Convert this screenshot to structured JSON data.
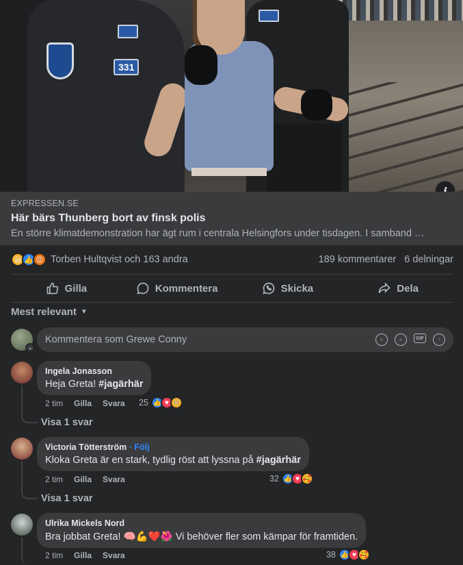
{
  "link": {
    "domain": "EXPRESSEN.SE",
    "title": "Här bärs Thunberg bort av finsk polis",
    "description": "En större klimatdemonstration har ägt rum i centrala Helsingfors under tisdagen. I samband …",
    "photo_badge_number": "331"
  },
  "summary": {
    "reactions": [
      "haha",
      "like",
      "angry"
    ],
    "names": "Torben Hultqvist och 163 andra",
    "comments": "189 kommentarer",
    "shares": "6 delningar"
  },
  "actions": {
    "like": "Gilla",
    "comment": "Kommentera",
    "send": "Skicka",
    "share": "Dela"
  },
  "sort_label": "Mest relevant",
  "composer": {
    "placeholder": "Kommentera som Grewe Conny"
  },
  "comments": [
    {
      "author": "Ingela Jonasson",
      "follow": "",
      "text": "Heja Greta! ",
      "tag": "#jagärhär",
      "time": "2 tim",
      "like": "Gilla",
      "reply": "Svara",
      "count": "25",
      "reactions": [
        "like",
        "love",
        "haha"
      ],
      "view_replies": "Visa 1 svar"
    },
    {
      "author": "Victoria Tötterström",
      "follow": "· Följ",
      "text": "Kloka Greta är en stark, tydlig röst att lyssna på ",
      "tag": "#jagärhär",
      "time": "2 tim",
      "like": "Gilla",
      "reply": "Svara",
      "count": "32",
      "reactions": [
        "like",
        "love",
        "care"
      ],
      "view_replies": "Visa 1 svar"
    },
    {
      "author": "Ulrika Mickels Nord",
      "follow": "",
      "text": "Bra jobbat Greta! 🧠💪❤️🌺 Vi behöver fler som kämpar för framtiden.",
      "tag": "",
      "time": "2 tim",
      "like": "Gilla",
      "reply": "Svara",
      "count": "38",
      "reactions": [
        "like",
        "love",
        "care"
      ]
    }
  ],
  "colors": {
    "background": "#242526",
    "surface": "#3a3b3c",
    "accent": "#2d88ff",
    "text_secondary": "#b0b3b8"
  }
}
